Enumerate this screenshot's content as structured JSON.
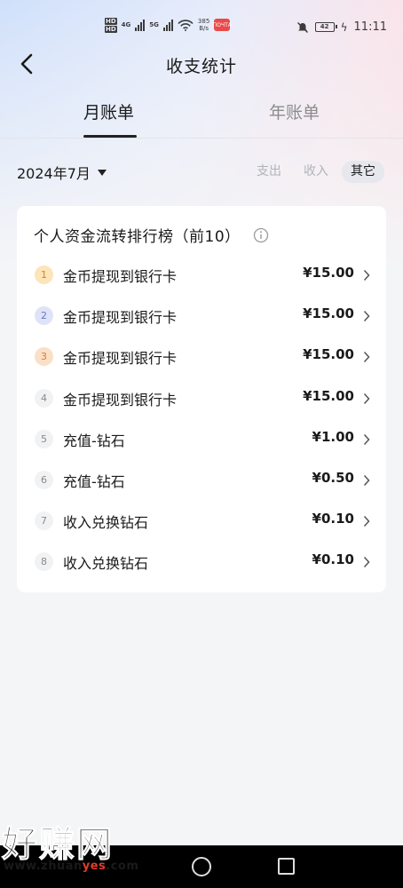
{
  "status_bar": {
    "hd1": "HD",
    "hd2": "HD",
    "net1": "4G",
    "net2": "5G",
    "speed_value": "385",
    "speed_unit": "B/s",
    "app_badge": "ПОЧТА",
    "battery": "42",
    "time": "11:11"
  },
  "header": {
    "title": "收支统计"
  },
  "tabs": {
    "month": "月账单",
    "year": "年账单",
    "active": "month"
  },
  "filter": {
    "month_label": "2024年7月",
    "segments": {
      "out": "支出",
      "in": "收入",
      "other": "其它"
    },
    "active_segment": "other"
  },
  "ranking": {
    "title": "个人资金流转排行榜（前10）",
    "items": [
      {
        "rank": "1",
        "name": "金币提现到银行卡",
        "amount": "¥15.00"
      },
      {
        "rank": "2",
        "name": "金币提现到银行卡",
        "amount": "¥15.00"
      },
      {
        "rank": "3",
        "name": "金币提现到银行卡",
        "amount": "¥15.00"
      },
      {
        "rank": "4",
        "name": "金币提现到银行卡",
        "amount": "¥15.00"
      },
      {
        "rank": "5",
        "name": "充值-钻石",
        "amount": "¥1.00"
      },
      {
        "rank": "6",
        "name": "充值-钻石",
        "amount": "¥0.50"
      },
      {
        "rank": "7",
        "name": "收入兑换钻石",
        "amount": "¥0.10"
      },
      {
        "rank": "8",
        "name": "收入兑换钻石",
        "amount": "¥0.10"
      }
    ]
  },
  "watermark": {
    "text": "好赚网",
    "url_prefix": "www.zhuan",
    "url_accent": "yes",
    "url_suffix": ".com"
  },
  "colors": {
    "rank1_badge": "#fde4b9",
    "rank2_badge": "#dfe3f8",
    "rank3_badge": "#fbdfc6",
    "active_segment_bg": "#e6e8ee"
  }
}
